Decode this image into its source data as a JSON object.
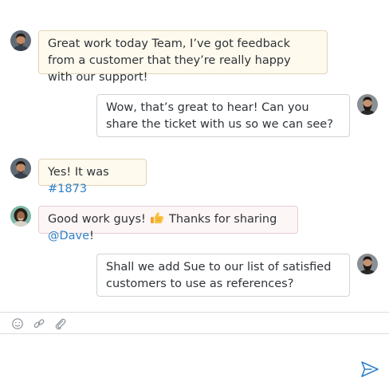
{
  "messages": [
    {
      "text": "Great work today Team, I’ve got feedback from a customer that they’re really happy with our support!"
    },
    {
      "text": "Wow, that’s great to hear! Can you share the ticket with us so we can see?"
    },
    {
      "text_before": "Yes! It was ",
      "ticket": "#1873"
    },
    {
      "text_before": "Good work guys! ",
      "emoji": "thumbs-up-icon",
      "text_mid": " Thanks for sharing ",
      "mention": "@Dave",
      "text_after": "!"
    },
    {
      "text": "Shall we add Sue to our list of satisfied customers to use as references?"
    }
  ],
  "composer": {
    "tools": [
      "emoji-icon",
      "link-icon",
      "attachment-icon"
    ],
    "send_icon": "send-icon"
  },
  "colors": {
    "link": "#2f80c9",
    "send": "#2f80c9",
    "bubble_yellow": "#fefaee",
    "bubble_pink": "#fdf6f6"
  }
}
